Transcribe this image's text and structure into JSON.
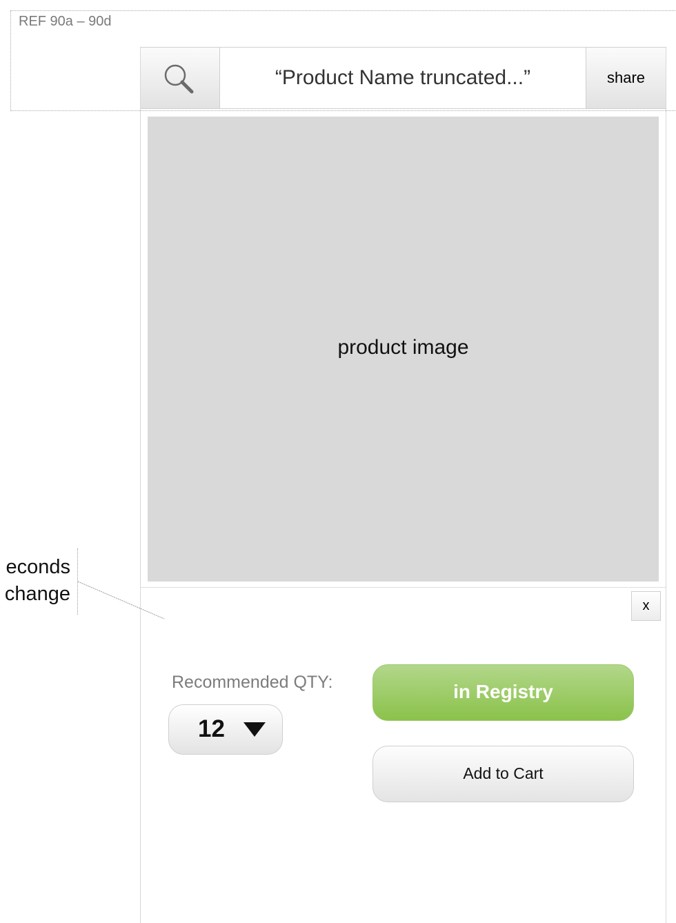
{
  "ref": {
    "label": "REF 90a – 90d"
  },
  "header": {
    "search_icon": "magnifier-icon",
    "product_title": "“Product Name truncated...”",
    "share_label": "share"
  },
  "product": {
    "image_label": "product image"
  },
  "annotation": {
    "line1": "econds",
    "line2": "change"
  },
  "overlay": {
    "close_label": "x",
    "qty_label": "Recommended QTY:",
    "qty_value": "12",
    "caret_icon": "caret-down-icon",
    "registry_label": "in Registry",
    "cart_label": "Add to Cart"
  },
  "colors": {
    "registry_green": "#8bc24b",
    "image_placeholder": "#d9d9d9",
    "muted_text": "#7c7c7c"
  }
}
